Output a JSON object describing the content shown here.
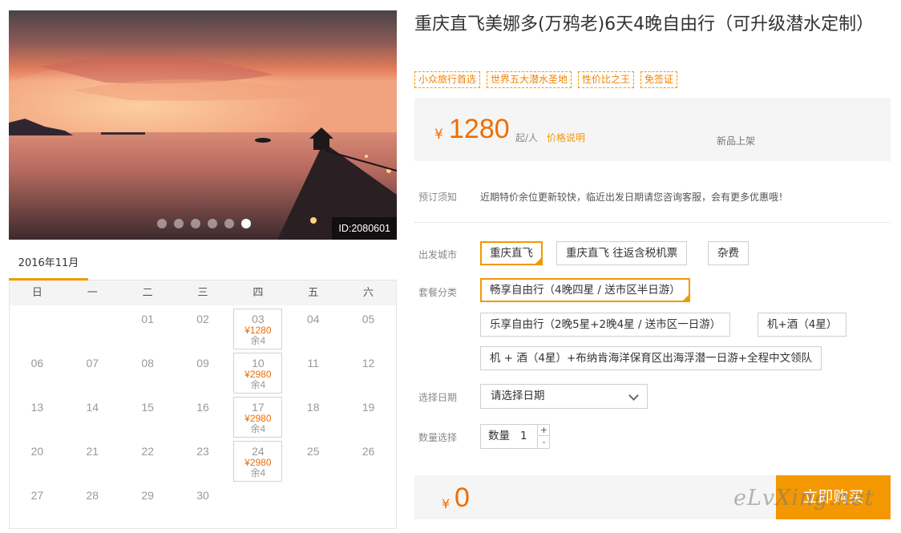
{
  "gallery": {
    "id_label": "ID:2080601",
    "slide_count": 6,
    "active_slide": 6
  },
  "calendar": {
    "month_tab": "2016年11月",
    "weekdays": [
      "日",
      "一",
      "二",
      "三",
      "四",
      "五",
      "六"
    ],
    "lead_blank_days": 2,
    "days": [
      {
        "d": "01"
      },
      {
        "d": "02"
      },
      {
        "d": "03",
        "price": "¥1280",
        "remain": "余4"
      },
      {
        "d": "04"
      },
      {
        "d": "05"
      },
      {
        "d": "06"
      },
      {
        "d": "07"
      },
      {
        "d": "08"
      },
      {
        "d": "09"
      },
      {
        "d": "10",
        "price": "¥2980",
        "remain": "余4"
      },
      {
        "d": "11"
      },
      {
        "d": "12"
      },
      {
        "d": "13"
      },
      {
        "d": "14"
      },
      {
        "d": "15"
      },
      {
        "d": "16"
      },
      {
        "d": "17",
        "price": "¥2980",
        "remain": "余4"
      },
      {
        "d": "18"
      },
      {
        "d": "19"
      },
      {
        "d": "20"
      },
      {
        "d": "21"
      },
      {
        "d": "22"
      },
      {
        "d": "23"
      },
      {
        "d": "24",
        "price": "¥2980",
        "remain": "余4"
      },
      {
        "d": "25"
      },
      {
        "d": "26"
      },
      {
        "d": "27"
      },
      {
        "d": "28"
      },
      {
        "d": "29"
      },
      {
        "d": "30"
      }
    ]
  },
  "product": {
    "title": "重庆直飞美娜多(万鸦老)6天4晚自由行（可升级潜水定制）",
    "tags": [
      "小众旅行首选",
      "世界五大潜水圣地",
      "性价比之王",
      "免签证"
    ]
  },
  "price": {
    "currency": "¥",
    "value": "1280",
    "unit": "起/人",
    "explain_link": "价格说明",
    "new_badge": "新品上架"
  },
  "notice": {
    "label": "预订须知",
    "text": "近期特价余位更新较快，临近出发日期请您咨询客服，会有更多优惠哦！"
  },
  "departure": {
    "label": "出发城市",
    "options": [
      "重庆直飞",
      "重庆直飞 往返含税机票",
      "杂费"
    ],
    "selected": 0
  },
  "package": {
    "label": "套餐分类",
    "options": [
      "畅享自由行（4晚四星 / 送市区半日游）",
      "乐享自由行（2晚5星+2晚4星 / 送市区一日游）",
      "机+酒（4星）",
      "机 + 酒（4星）+布纳肯海洋保育区出海浮潜一日游+全程中文领队"
    ],
    "selected": 0
  },
  "date_select": {
    "label": "选择日期",
    "placeholder": "请选择日期"
  },
  "quantity": {
    "label": "数量选择",
    "field_label": "数量",
    "value": "1",
    "plus": "+",
    "minus": "-"
  },
  "total": {
    "currency": "¥",
    "value": "0",
    "buy_label": "立即购买"
  },
  "watermark": "eLvXing.net",
  "colors": {
    "accent": "#f39800",
    "price": "#f06d00"
  }
}
